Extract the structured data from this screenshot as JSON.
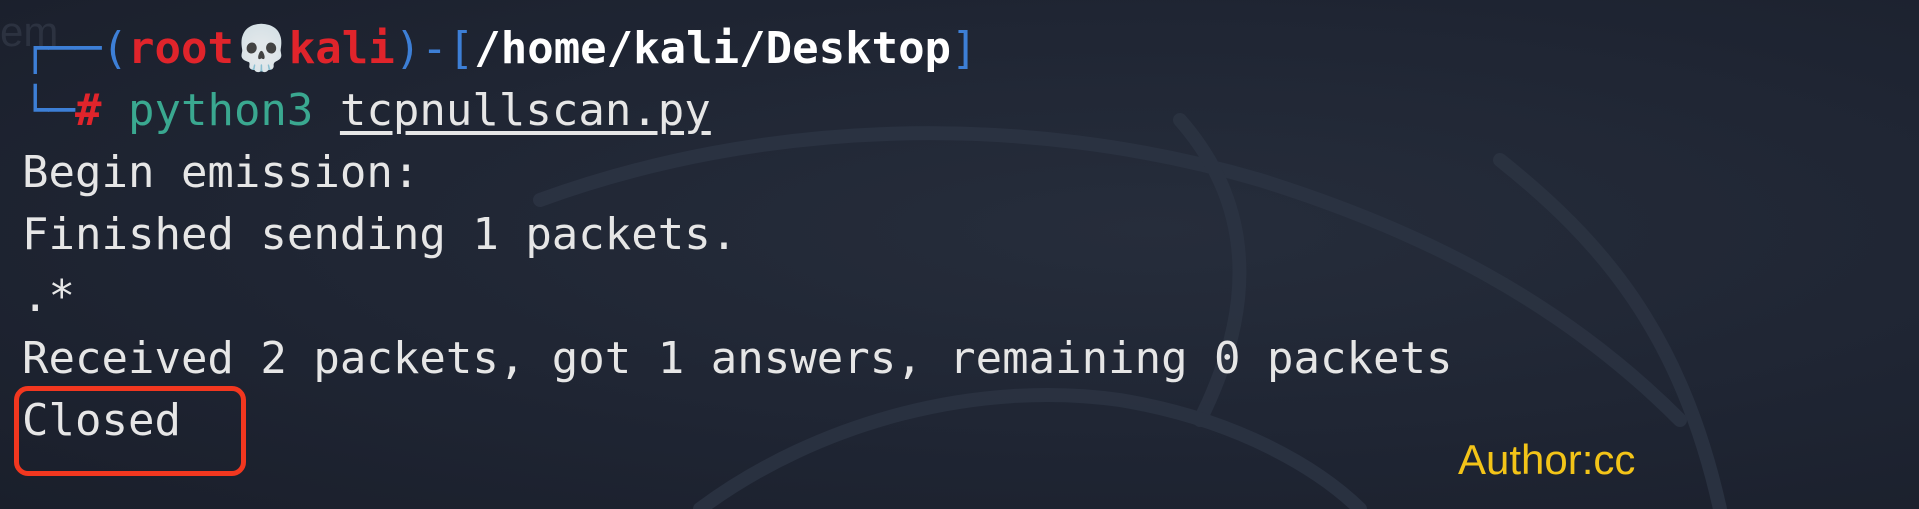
{
  "prompt": {
    "frame_top": "┌──",
    "frame_bottom": "└─",
    "open_paren": "(",
    "user": "root",
    "skull": "💀",
    "host": "kali",
    "close_paren": ")",
    "dash": "-",
    "open_bracket": "[",
    "cwd": "/home/kali/Desktop",
    "close_bracket": "]",
    "symbol": "#"
  },
  "command": {
    "program": "python3",
    "argument": "tcpnullscan.py"
  },
  "output": [
    "Begin emission:",
    "Finished sending 1 packets.",
    ".*",
    "Received 2 packets, got 1 answers, remaining 0 packets",
    "Closed"
  ],
  "watermark": {
    "author": "Author:cc",
    "ghost_text": "em"
  },
  "colors": {
    "background": "#1f2533",
    "frame": "#3d7fd6",
    "prompt_red": "#e0242b",
    "command_green": "#3aa890",
    "highlight": "#f2371f",
    "author_yellow": "#f3c418"
  }
}
